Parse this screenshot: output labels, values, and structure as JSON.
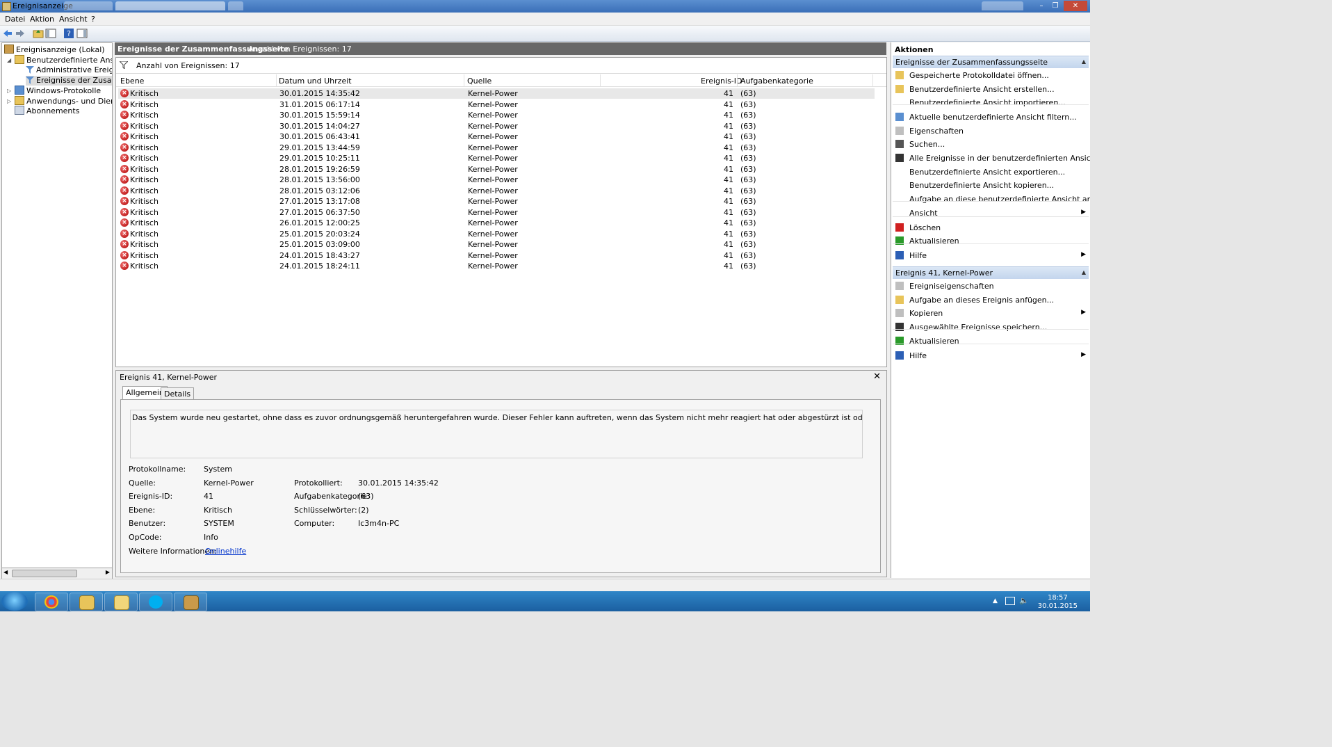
{
  "window": {
    "title": "Ereignisanzeige"
  },
  "menu": [
    "Datei",
    "Aktion",
    "Ansicht",
    "?"
  ],
  "tree": {
    "root": "Ereignisanzeige (Lokal)",
    "custom_views": "Benutzerdefinierte Ansichten",
    "admin_events": "Administrative Ereignisse",
    "summary_events": "Ereignisse der Zusammenfassungsseite",
    "windows_logs": "Windows-Protokolle",
    "app_logs": "Anwendungs- und Dienstprotokolle",
    "subscriptions": "Abonnements"
  },
  "center": {
    "header_title": "Ereignisse der Zusammenfassungsseite",
    "header_count": "Anzahl von Ereignissen: 17",
    "filter_text": "Anzahl von Ereignissen: 17",
    "columns": [
      "Ebene",
      "Datum und Uhrzeit",
      "Quelle",
      "Ereignis-ID",
      "Aufgabenkategorie"
    ],
    "rows": [
      {
        "level": "Kritisch",
        "date": "30.01.2015 14:35:42",
        "source": "Kernel-Power",
        "id": "41",
        "category": "(63)"
      },
      {
        "level": "Kritisch",
        "date": "31.01.2015 06:17:14",
        "source": "Kernel-Power",
        "id": "41",
        "category": "(63)"
      },
      {
        "level": "Kritisch",
        "date": "30.01.2015 15:59:14",
        "source": "Kernel-Power",
        "id": "41",
        "category": "(63)"
      },
      {
        "level": "Kritisch",
        "date": "30.01.2015 14:04:27",
        "source": "Kernel-Power",
        "id": "41",
        "category": "(63)"
      },
      {
        "level": "Kritisch",
        "date": "30.01.2015 06:43:41",
        "source": "Kernel-Power",
        "id": "41",
        "category": "(63)"
      },
      {
        "level": "Kritisch",
        "date": "29.01.2015 13:44:59",
        "source": "Kernel-Power",
        "id": "41",
        "category": "(63)"
      },
      {
        "level": "Kritisch",
        "date": "29.01.2015 10:25:11",
        "source": "Kernel-Power",
        "id": "41",
        "category": "(63)"
      },
      {
        "level": "Kritisch",
        "date": "28.01.2015 19:26:59",
        "source": "Kernel-Power",
        "id": "41",
        "category": "(63)"
      },
      {
        "level": "Kritisch",
        "date": "28.01.2015 13:56:00",
        "source": "Kernel-Power",
        "id": "41",
        "category": "(63)"
      },
      {
        "level": "Kritisch",
        "date": "28.01.2015 03:12:06",
        "source": "Kernel-Power",
        "id": "41",
        "category": "(63)"
      },
      {
        "level": "Kritisch",
        "date": "27.01.2015 13:17:08",
        "source": "Kernel-Power",
        "id": "41",
        "category": "(63)"
      },
      {
        "level": "Kritisch",
        "date": "27.01.2015 06:37:50",
        "source": "Kernel-Power",
        "id": "41",
        "category": "(63)"
      },
      {
        "level": "Kritisch",
        "date": "26.01.2015 12:00:25",
        "source": "Kernel-Power",
        "id": "41",
        "category": "(63)"
      },
      {
        "level": "Kritisch",
        "date": "25.01.2015 20:03:24",
        "source": "Kernel-Power",
        "id": "41",
        "category": "(63)"
      },
      {
        "level": "Kritisch",
        "date": "25.01.2015 03:09:00",
        "source": "Kernel-Power",
        "id": "41",
        "category": "(63)"
      },
      {
        "level": "Kritisch",
        "date": "24.01.2015 18:43:27",
        "source": "Kernel-Power",
        "id": "41",
        "category": "(63)"
      },
      {
        "level": "Kritisch",
        "date": "24.01.2015 18:24:11",
        "source": "Kernel-Power",
        "id": "41",
        "category": "(63)"
      }
    ]
  },
  "detail": {
    "title": "Ereignis 41, Kernel-Power",
    "tab_general": "Allgemein",
    "tab_details": "Details",
    "description": "Das System wurde neu gestartet, ohne dass es zuvor ordnungsgemäß heruntergefahren wurde. Dieser Fehler kann auftreten, wenn das System nicht mehr reagiert hat oder abgestürzt ist oder die Stromzufuhr unerwartet unterbrochen wurde.",
    "l_logname": "Protokollname:",
    "v_logname": "System",
    "l_source": "Quelle:",
    "v_source": "Kernel-Power",
    "l_logged": "Protokolliert:",
    "v_logged": "30.01.2015 14:35:42",
    "l_eventid": "Ereignis-ID:",
    "v_eventid": "41",
    "l_taskcat": "Aufgabenkategorie:",
    "v_taskcat": "(63)",
    "l_level": "Ebene:",
    "v_level": "Kritisch",
    "l_keywords": "Schlüsselwörter:",
    "v_keywords": "(2)",
    "l_user": "Benutzer:",
    "v_user": "SYSTEM",
    "l_computer": "Computer:",
    "v_computer": "Ic3m4n-PC",
    "l_opcode": "OpCode:",
    "v_opcode": "Info",
    "l_moreinfo": "Weitere Informationen:",
    "v_moreinfo": "Onlinehilfe"
  },
  "actions": {
    "title": "Aktionen",
    "section1": "Ereignisse der Zusammenfassungsseite",
    "items1": [
      "Gespeicherte Protokolldatei öffnen...",
      "Benutzerdefinierte Ansicht erstellen...",
      "Benutzerdefinierte Ansicht importieren...",
      "Aktuelle benutzerdefinierte Ansicht filtern...",
      "Eigenschaften",
      "Suchen...",
      "Alle Ereignisse in der benutzerdefinierten Ansicht speic...",
      "Benutzerdefinierte Ansicht exportieren...",
      "Benutzerdefinierte Ansicht kopieren...",
      "Aufgabe an diese benutzerdefinierte Ansicht anfügen...",
      "Ansicht",
      "Löschen",
      "Aktualisieren",
      "Hilfe"
    ],
    "section2": "Ereignis 41, Kernel-Power",
    "items2": [
      "Ereigniseigenschaften",
      "Aufgabe an dieses Ereignis anfügen...",
      "Kopieren",
      "Ausgewählte Ereignisse speichern...",
      "Aktualisieren",
      "Hilfe"
    ]
  },
  "taskbar": {
    "time": "18:57",
    "date": "30.01.2015"
  },
  "colors": {
    "header_bg": "#686868",
    "section_bg": "#c9daf0",
    "error_red": "#c00000",
    "link": "#0033cc",
    "taskbar": "#1f6fb8"
  }
}
